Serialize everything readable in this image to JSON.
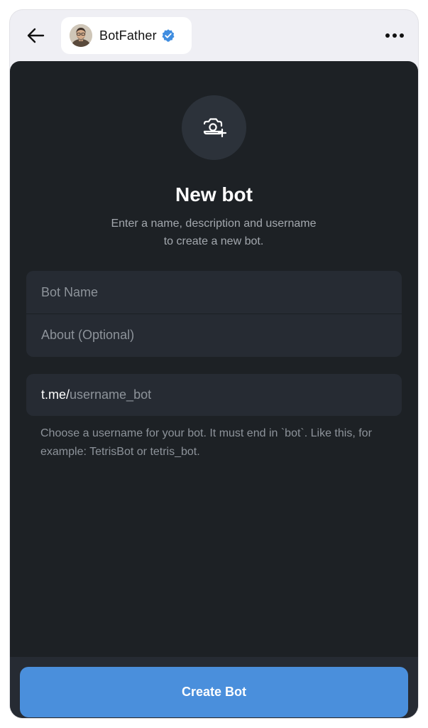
{
  "header": {
    "chat_name": "BotFather",
    "back_icon": "arrow-left-icon",
    "more_icon": "more-horizontal-icon",
    "verified_icon": "verified-badge-icon",
    "verified_color": "#3f8de0"
  },
  "form": {
    "photo_icon": "camera-add-icon",
    "title": "New bot",
    "subtitle": "Enter a name, description and username to create a new bot.",
    "bot_name_placeholder": "Bot Name",
    "about_placeholder": "About (Optional)",
    "username_prefix": "t.me/",
    "username_placeholder": "username_bot",
    "hint": "Choose a username for your bot. It must end in `bot`. Like this, for example: TetrisBot or tetris_bot."
  },
  "footer": {
    "create_button_label": "Create Bot",
    "accent_color": "#4a8fdc"
  }
}
